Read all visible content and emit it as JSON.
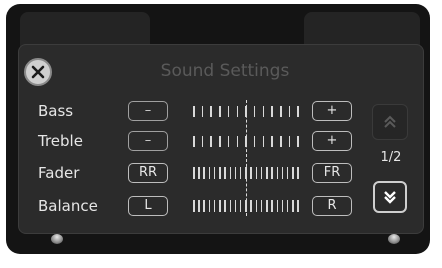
{
  "header": {
    "title": "Sound Settings"
  },
  "rows": [
    {
      "label": "Bass",
      "minus_label": "–",
      "plus_label": "+"
    },
    {
      "label": "Treble",
      "minus_label": "–",
      "plus_label": "+"
    },
    {
      "label": "Fader",
      "minus_label": "RR",
      "plus_label": "FR"
    },
    {
      "label": "Balance",
      "minus_label": "L",
      "plus_label": "R"
    }
  ],
  "pagination": {
    "indicator": "1/2"
  },
  "icons": {
    "close": "close-icon",
    "scroll_up": "double-chevron-up-icon",
    "scroll_down": "double-chevron-down-icon"
  },
  "colors": {
    "screen_bg": "#2b2b2b",
    "bezel": "#141414",
    "text": "#e6e6e6"
  }
}
